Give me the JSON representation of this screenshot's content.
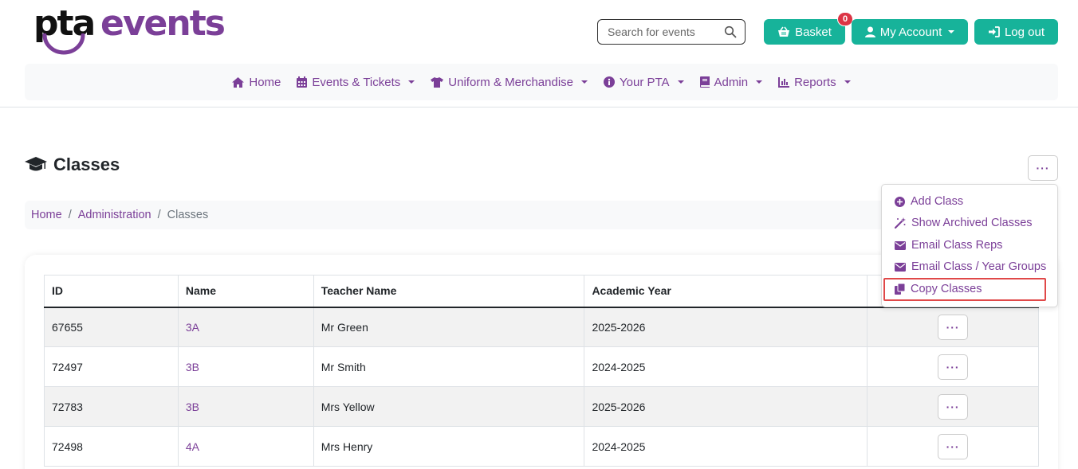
{
  "logo": {
    "part1": "pta",
    "part2": "events"
  },
  "search": {
    "placeholder": "Search for events"
  },
  "header": {
    "basket_label": "Basket",
    "basket_count": "0",
    "account_label": "My Account",
    "logout_label": "Log out"
  },
  "nav": {
    "items": [
      {
        "label": "Home",
        "icon": "home-icon"
      },
      {
        "label": "Events & Tickets",
        "icon": "calendar-icon"
      },
      {
        "label": "Uniform & Merchandise",
        "icon": "shirt-icon"
      },
      {
        "label": "Your PTA",
        "icon": "info-icon"
      },
      {
        "label": "Admin",
        "icon": "book-icon"
      },
      {
        "label": "Reports",
        "icon": "chart-icon"
      }
    ]
  },
  "page": {
    "title": "Classes",
    "actions_label": "···"
  },
  "breadcrumb": {
    "home": "Home",
    "admin": "Administration",
    "current": "Classes"
  },
  "table": {
    "headers": [
      "ID",
      "Name",
      "Teacher Name",
      "Academic Year"
    ],
    "rows": [
      {
        "id": "67655",
        "name": "3A",
        "teacher": "Mr Green",
        "year": "2025-2026"
      },
      {
        "id": "72497",
        "name": "3B",
        "teacher": "Mr Smith",
        "year": "2024-2025"
      },
      {
        "id": "72783",
        "name": "3B",
        "teacher": "Mrs Yellow",
        "year": "2025-2026"
      },
      {
        "id": "72498",
        "name": "4A",
        "teacher": "Mrs Henry",
        "year": "2024-2025"
      }
    ],
    "row_action": "···"
  },
  "dropdown": {
    "items": [
      {
        "label": "Add Class",
        "icon": "plus-circle-icon"
      },
      {
        "label": "Show Archived Classes",
        "icon": "magic-wand-icon"
      },
      {
        "label": "Email Class Reps",
        "icon": "envelope-icon"
      },
      {
        "label": "Email Class / Year Groups",
        "icon": "envelope-icon"
      },
      {
        "label": "Copy Classes",
        "icon": "copy-icon"
      }
    ],
    "highlighted": "Copy Classes"
  },
  "colors": {
    "brand": "#7b3f98",
    "accent": "#17b39a",
    "badge": "#dc3545",
    "highlight": "#e04848"
  }
}
